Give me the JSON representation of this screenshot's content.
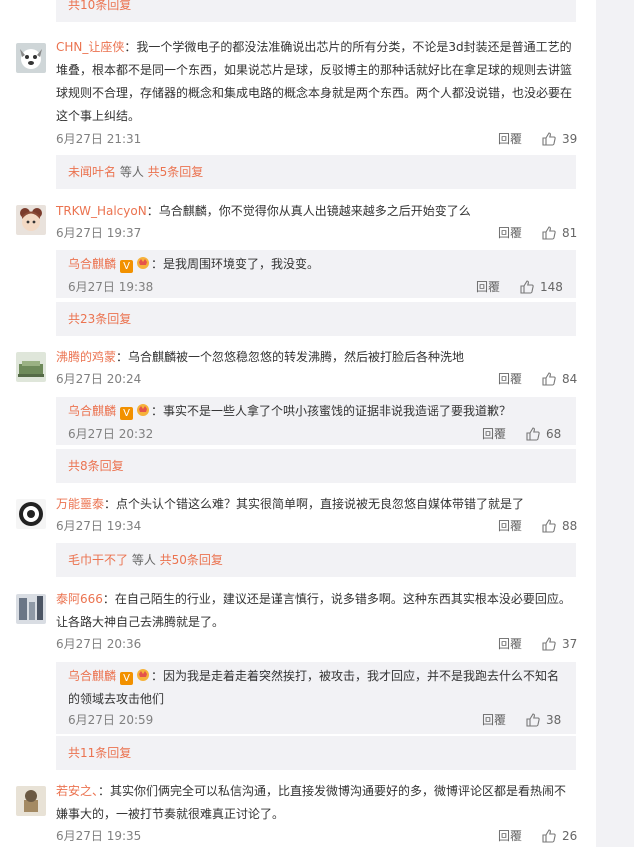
{
  "top_more": "共10条回复",
  "reply_label": "回覆",
  "colors": {
    "link": "#eb7350",
    "gray": "#808080",
    "panel_bg": "#f2f2f5"
  },
  "comments": [
    {
      "name": "CHN_让座侠",
      "text": "：我一个学微电子的都没法准确说出芯片的所有分类，不论是3d封装还是普通工艺的堆叠，根本都不是同一个东西，如果说芯片是球，反驳博主的那种话就好比在拿足球的规则去讲篮球规则不合理，存储器的概念和集成电路的概念本身就是两个东西。两个人都没说错，也没必要在这个事上纠结。",
      "time": "6月27日 21:31",
      "likes": "39",
      "more_prefix": "未闻叶名",
      "more_mid": " 等人 ",
      "more_link": "共5条回复"
    },
    {
      "name": "TRKW_HalcyoN",
      "text": "：乌合麒麟，你不觉得你从真人出镜越来越多之后开始变了么",
      "time": "6月27日 19:37",
      "likes": "81",
      "reply": {
        "name": "乌合麒麟",
        "text": "：是我周围环境变了，我没变。",
        "time": "6月27日 19:38",
        "likes": "148"
      },
      "more_link": "共23条回复"
    },
    {
      "name": "沸腾的鸡蒙",
      "text": "：乌合麒麟被一个忽悠稳忽悠的转发沸腾，然后被打脸后各种洗地",
      "time": "6月27日 20:24",
      "likes": "84",
      "reply": {
        "name": "乌合麒麟",
        "text": "：事实不是一些人拿了个哄小孩蜜饯的证据非说我造谣了要我道歉？",
        "time": "6月27日 20:32",
        "likes": "68"
      },
      "more_link": "共8条回复"
    },
    {
      "name": "万能噩泰",
      "text": "：点个头认个错这么难？其实很简单啊，直接说被无良忽悠自媒体带错了就是了",
      "time": "6月27日 19:34",
      "likes": "88",
      "more_prefix": "毛巾干不了",
      "more_mid": " 等人 ",
      "more_link": "共50条回复"
    },
    {
      "name": "泰阿666",
      "text": "：在自己陌生的行业，建议还是谨言慎行，说多错多啊。这种东西其实根本没必要回应。让各路大神自己去沸腾就是了。",
      "time": "6月27日 20:36",
      "likes": "37",
      "reply": {
        "name": "乌合麒麟",
        "text": "：因为我是走着走着突然挨打，被攻击，我才回应，并不是我跑去什么不知名的领域去攻击他们",
        "time": "6月27日 20:59",
        "likes": "38"
      },
      "more_link": "共11条回复"
    },
    {
      "name": "若安之、",
      "text": "：其实你们俩完全可以私信沟通，比直接发微博沟通要好的多，微博评论区都是看热闹不嫌事大的，一被打节奏就很难真正讨论了。",
      "time": "6月27日 19:35",
      "likes": "26"
    }
  ]
}
